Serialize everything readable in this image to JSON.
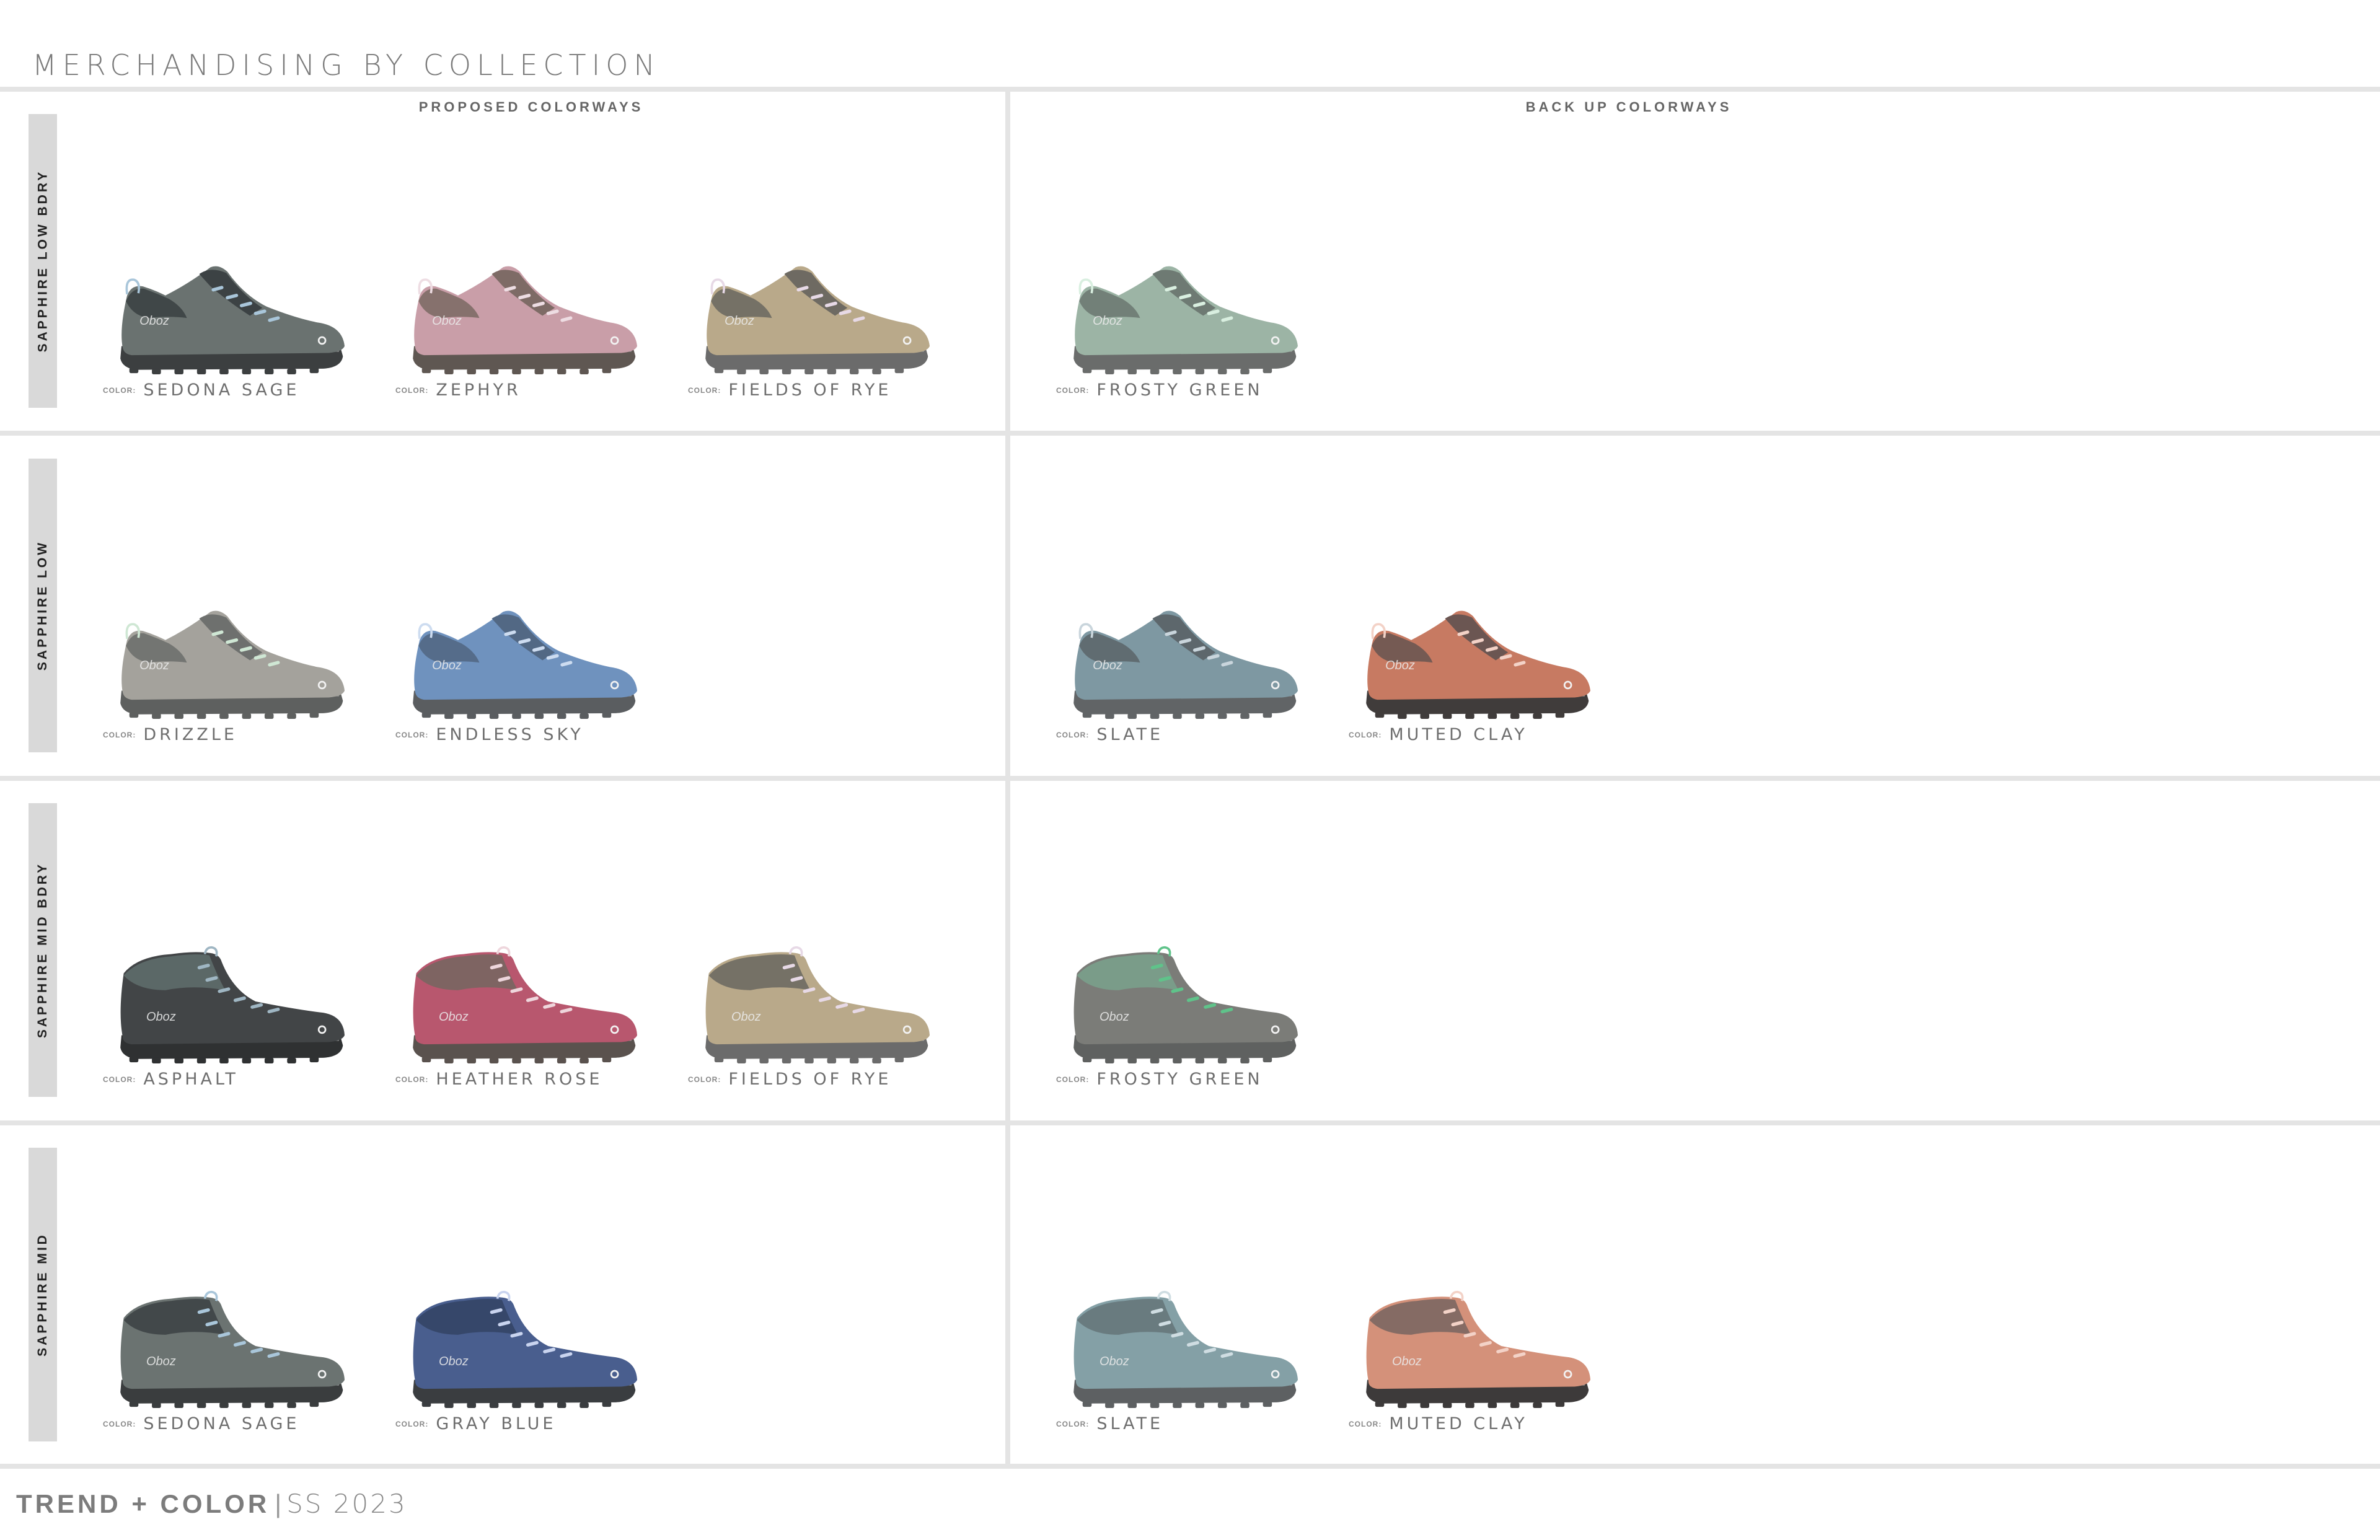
{
  "title": "MERCHANDISING BY COLLECTION",
  "columns": {
    "proposed": "PROPOSED COLORWAYS",
    "backup": "BACK UP COLORWAYS"
  },
  "color_prefix": "COLOR:",
  "footer": {
    "brand": "TREND + COLOR",
    "separator": "|",
    "season": "SS 2023"
  },
  "rows": [
    {
      "name": "SAPPHIRE LOW BDRY",
      "style": "low",
      "proposed": [
        {
          "color": "SEDONA SAGE",
          "upper": "#6a7270",
          "accent": "#3c4244",
          "sole": "#3c3f40",
          "lace": "#a9c6da"
        },
        {
          "color": "ZEPHYR",
          "upper": "#c99ea8",
          "accent": "#7e6b66",
          "sole": "#5f5752",
          "lace": "#eedde3"
        },
        {
          "color": "FIELDS OF RYE",
          "upper": "#b9a98a",
          "accent": "#6e6a62",
          "sole": "#6b6b6b",
          "lace": "#e7d9e6"
        }
      ],
      "backup": [
        {
          "color": "FROSTY GREEN",
          "upper": "#9cb4a5",
          "accent": "#6e7a73",
          "sole": "#6a6c6b",
          "lace": "#d9efe0"
        }
      ]
    },
    {
      "name": "SAPPHIRE LOW",
      "style": "low",
      "proposed": [
        {
          "color": "DRIZZLE",
          "upper": "#a4a29c",
          "accent": "#6e706e",
          "sole": "#5e605f",
          "lace": "#cfe7d4"
        },
        {
          "color": "ENDLESS SKY",
          "upper": "#6f92be",
          "accent": "#526884",
          "sole": "#5a5d60",
          "lace": "#cddcf0"
        }
      ],
      "backup": [
        {
          "color": "SLATE",
          "upper": "#7e98a2",
          "accent": "#5d676c",
          "sole": "#616466",
          "lace": "#c9d5dc"
        },
        {
          "color": "MUTED CLAY",
          "upper": "#c77a62",
          "accent": "#6b5652",
          "sole": "#403c3b",
          "lace": "#f3d2c7"
        }
      ]
    },
    {
      "name": "SAPPHIRE MID BDRY",
      "style": "mid",
      "proposed": [
        {
          "color": "ASPHALT",
          "upper": "#424547",
          "accent": "#5e6b6a",
          "sole": "#2f3132",
          "lace": "#9fb6c3"
        },
        {
          "color": "HEATHER ROSE",
          "upper": "#b8576e",
          "accent": "#786660",
          "sole": "#5a524e",
          "lace": "#eed6dc"
        },
        {
          "color": "FIELDS OF RYE",
          "upper": "#b9a98a",
          "accent": "#6e6a62",
          "sole": "#6b6b6b",
          "lace": "#e7d9e6"
        }
      ],
      "backup": [
        {
          "color": "FROSTY GREEN",
          "upper": "#7b7c78",
          "accent": "#7aa08b",
          "sole": "#5f6160",
          "lace": "#5fc38a"
        }
      ]
    },
    {
      "name": "SAPPHIRE MID",
      "style": "mid",
      "proposed": [
        {
          "color": "SEDONA SAGE",
          "upper": "#6b7371",
          "accent": "#3e4446",
          "sole": "#3a3d3e",
          "lace": "#a9c6da"
        },
        {
          "color": "GRAY BLUE",
          "upper": "#495e8e",
          "accent": "#344566",
          "sole": "#3a3d40",
          "lace": "#c9d4ef"
        }
      ],
      "backup": [
        {
          "color": "SLATE",
          "upper": "#84a0a6",
          "accent": "#66777b",
          "sole": "#5d6062",
          "lace": "#cfdde2"
        },
        {
          "color": "MUTED CLAY",
          "upper": "#d4917a",
          "accent": "#7c6762",
          "sole": "#3d3a3a",
          "lace": "#f3d2c7"
        }
      ]
    }
  ]
}
